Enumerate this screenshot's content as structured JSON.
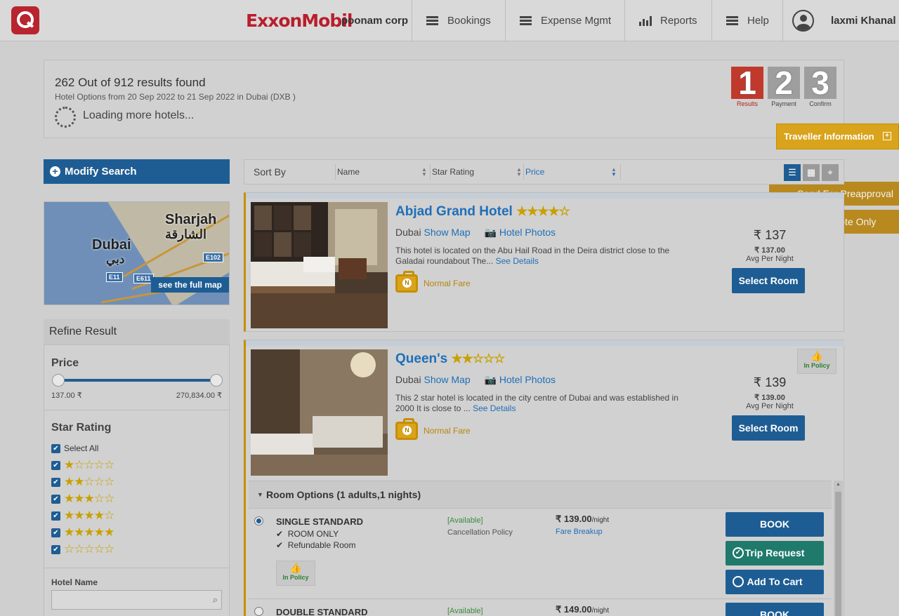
{
  "header": {
    "brand": "ExxonMobil",
    "corp": "poonam corp",
    "nav": [
      "Bookings",
      "Expense Mgmt",
      "Reports",
      "Help"
    ],
    "user": "laxmi Khanal"
  },
  "summary": {
    "count": "262 Out of 912 results found",
    "sub": "Hotel Options from  20 Sep 2022 to 21 Sep 2022 in Dubai (DXB )",
    "loading": "Loading more hotels...",
    "steps": [
      {
        "num": "1",
        "label": "Results"
      },
      {
        "num": "2",
        "label": "Payment"
      },
      {
        "num": "3",
        "label": "Confirm"
      }
    ]
  },
  "side": {
    "traveller": "Traveller Information",
    "preapproval": "Send For Preapproval",
    "quote": "Send Quote Only"
  },
  "modify_search": "Modify Search",
  "map": {
    "labels": [
      "Sharjah",
      "الشارقة",
      "Dubai",
      "دبي"
    ],
    "shields": [
      "E102",
      "E11",
      "E611"
    ],
    "full_map": "see the full map"
  },
  "refine": {
    "title": "Refine Result",
    "price_title": "Price",
    "price_min": "137.00 ₹",
    "price_max": "270,834.00 ₹",
    "price_range_fraction": [
      0,
      1
    ],
    "star_title": "Star Rating",
    "select_all": "Select All",
    "star_levels": [
      1,
      2,
      3,
      4,
      5,
      0
    ],
    "hotel_name_label": "Hotel Name",
    "hotel_name_value": ""
  },
  "sort": {
    "label": "Sort By",
    "cols": [
      "Name",
      "Star Rating",
      "Price"
    ]
  },
  "hotels": [
    {
      "name": "Abjad Grand Hotel",
      "stars": 4,
      "city": "Dubai",
      "show_map": "Show Map",
      "photos": "Hotel Photos",
      "desc": "This hotel is located on the Abu Hail Road in the Deira district close to the Galadai roundabout The...",
      "see": "See Details",
      "fare": "Normal Fare",
      "price_big": "₹ 137",
      "price_small": "₹ 137.00",
      "avg": "Avg Per Night",
      "select": "Select Room"
    },
    {
      "name": "Queen's",
      "stars": 2,
      "city": "Dubai",
      "show_map": "Show Map",
      "photos": "Hotel Photos",
      "desc": "This 2 star hotel is located in the city centre of Dubai and was established in 2000 It is close to ...",
      "see": "See Details",
      "fare": "Normal Fare",
      "price_big": "₹ 139",
      "price_small": "₹ 139.00",
      "avg": "Avg Per Night",
      "select": "Select Room",
      "policy": "In Policy"
    }
  ],
  "room_options": {
    "title": "Room Options (1 adults,1 nights)",
    "rooms": [
      {
        "type": "SINGLE STANDARD",
        "features": [
          "ROOM ONLY",
          "Refundable Room"
        ],
        "avail": "[Available]",
        "cancel": "Cancellation Policy",
        "price": "₹ 139.00",
        "per": "/night",
        "breakup": "Fare Breakup",
        "policy": "In Policy",
        "book": "BOOK",
        "trip": "Trip Request",
        "cart": "Add To Cart"
      },
      {
        "type": "DOUBLE STANDARD",
        "avail": "[Available]",
        "price": "₹ 149.00",
        "per": "/night",
        "book": "BOOK"
      }
    ]
  },
  "colors": {
    "primary": "#1e5d93",
    "accent": "#c68f00",
    "brand": "#b81e2c",
    "link": "#1e6fb8"
  }
}
